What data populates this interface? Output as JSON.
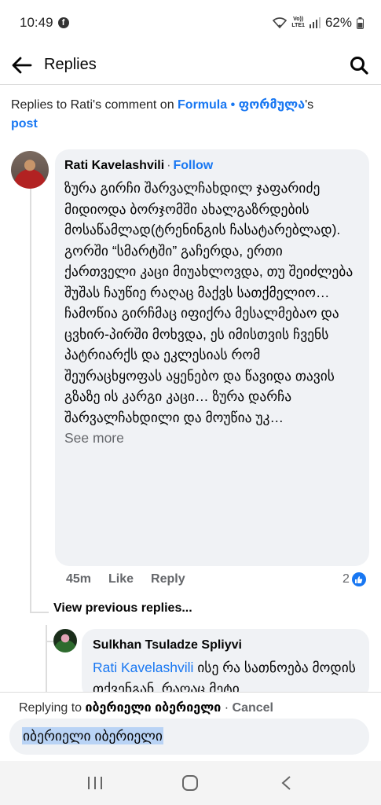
{
  "status_bar": {
    "time": "10:49",
    "fb_glyph": "f",
    "volte": "Vo))\nLTE1",
    "battery": "62%"
  },
  "header": {
    "title": "Replies"
  },
  "context": {
    "prefix": "Replies to Rati's comment on ",
    "page_name": "Formula • ფორმულა",
    "suffix": "'s",
    "post_link": "post"
  },
  "comment": {
    "author": "Rati Kavelashvili",
    "separator": "·",
    "follow_label": "Follow",
    "text": "ზურა გირჩი შარვალჩახდილ ჯაფარიძე მიდიოდა ბორჯომში ახალგაზრდების მოსაწამლად(ტრენინგის ჩასატარებლად).\nგორში “სმარტში” გაჩერდა, ერთი ქართველი კაცი მიუახლოვდა, თუ შეიძლება შუშას ჩაუწიე რაღაც მაქვს სათქმელიო… ჩამოწია გირჩმაც იფიქრა მესალმებაო და ცვხირ-პირში მოხვდა, ეს იმისთვის ჩვენს პატრიარქს და ეკლესიას რომ შეურაცხყოფას აყენებო და წავიდა თავის გზაზე ის კარგი კაცი… ზურა დარჩა შარვალჩახდილი და მოუწია უკ…",
    "see_more": "See more",
    "time": "45m",
    "like_label": "Like",
    "reply_label": "Reply",
    "reaction_count": "2"
  },
  "view_previous": "View previous replies...",
  "reply": {
    "author": "Sulkhan Tsuladze Splіyvi",
    "mention": "Rati Kavelashvili",
    "text": " ისე რა სათნოება მოდის თქვენგან, რაღაც მეტი"
  },
  "reply_bar": {
    "replying_to": "Replying to ",
    "name": "იბერიელი იბერიელი",
    "separator": " · ",
    "cancel": "Cancel",
    "input_value": "იბერიელი იბერიელი"
  },
  "nav": {
    "recent": "|||",
    "home": "○",
    "back": "<"
  },
  "colors": {
    "link": "#1877f2",
    "bubble": "#f0f2f5",
    "muted": "#65676b"
  }
}
